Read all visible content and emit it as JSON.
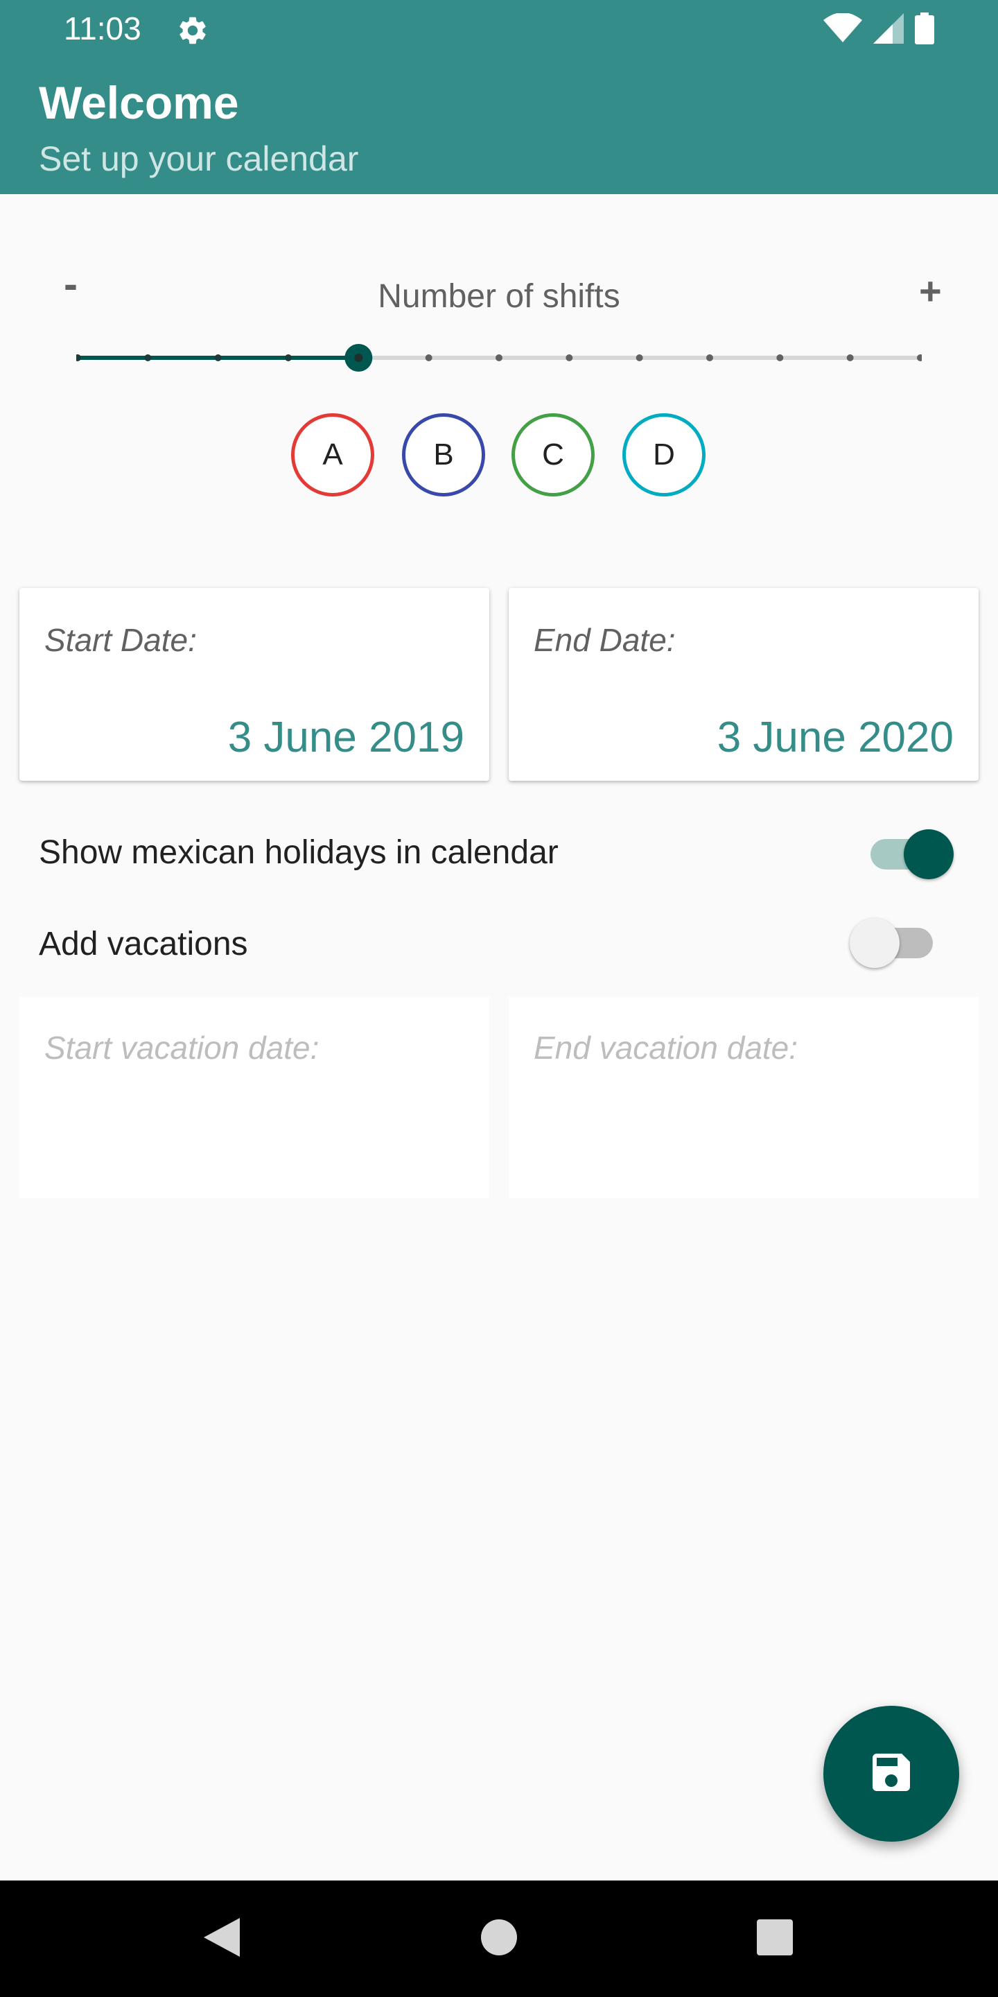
{
  "status_bar": {
    "time": "11:03",
    "icons": [
      "gear-icon",
      "wifi-icon",
      "signal-icon",
      "battery-icon"
    ]
  },
  "app_bar": {
    "title": "Welcome",
    "subtitle": "Set up your calendar",
    "color": "#348d89"
  },
  "shifts": {
    "label": "Number of shifts",
    "minus_label": "-",
    "plus_label": "+",
    "slider_steps": 13,
    "slider_selected_index": 4,
    "items": [
      {
        "label": "A",
        "color": "#e53935"
      },
      {
        "label": "B",
        "color": "#3949ab"
      },
      {
        "label": "C",
        "color": "#43a047"
      },
      {
        "label": "D",
        "color": "#00acc1"
      }
    ]
  },
  "dates": {
    "start_label": "Start Date:",
    "start_value": "3 June 2019",
    "end_label": "End Date:",
    "end_value": "3 June 2020"
  },
  "settings": {
    "holidays_label": "Show mexican holidays in calendar",
    "holidays_on": true,
    "vacations_label": "Add vacations",
    "vacations_on": false
  },
  "vacation": {
    "start_placeholder": "Start vacation date:",
    "end_placeholder": "End vacation date:"
  },
  "fab": {
    "icon": "save-icon",
    "color": "#00574f"
  },
  "navbar": {
    "icons": [
      "back-icon",
      "home-icon",
      "recents-icon"
    ]
  }
}
